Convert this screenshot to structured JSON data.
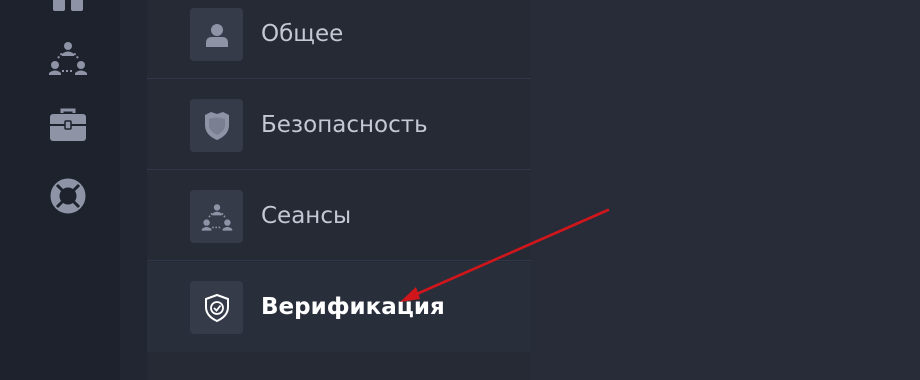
{
  "left_rail": {
    "icons": [
      "grid-icon",
      "team-icon",
      "briefcase-icon",
      "lifebuoy-icon"
    ]
  },
  "settings_menu": {
    "items": [
      {
        "label": "Общее",
        "icon": "user-icon",
        "active": false
      },
      {
        "label": "Безопасность",
        "icon": "shield-icon",
        "active": false
      },
      {
        "label": "Сеансы",
        "icon": "sessions-icon",
        "active": false
      },
      {
        "label": "Верификация",
        "icon": "shield-check-icon",
        "active": true
      }
    ]
  },
  "annotation": {
    "type": "arrow",
    "color": "#d0161b"
  },
  "colors": {
    "rail_bg": "#1e222c",
    "menu_bg": "#262a35",
    "active_bg": "#292e3b",
    "icon_box": "#363b4a",
    "icon": "#8e94a6",
    "text": "#c3c8d4",
    "text_active": "#ffffff"
  }
}
